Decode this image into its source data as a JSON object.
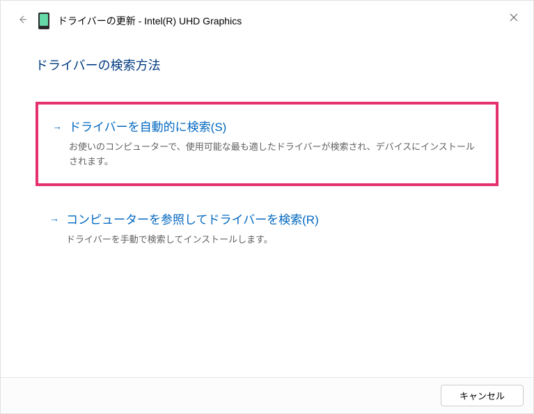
{
  "header": {
    "title_prefix": "ドライバーの更新 - ",
    "device_name": "Intel(R) UHD Graphics"
  },
  "content": {
    "section_title": "ドライバーの検索方法",
    "options": [
      {
        "arrow": "→",
        "title": "ドライバーを自動的に検索(S)",
        "description": "お使いのコンピューターで、使用可能な最も適したドライバーが検索され、デバイスにインストールされます。"
      },
      {
        "arrow": "→",
        "title": "コンピューターを参照してドライバーを検索(R)",
        "description": "ドライバーを手動で検索してインストールします。"
      }
    ]
  },
  "footer": {
    "cancel_label": "キャンセル"
  }
}
